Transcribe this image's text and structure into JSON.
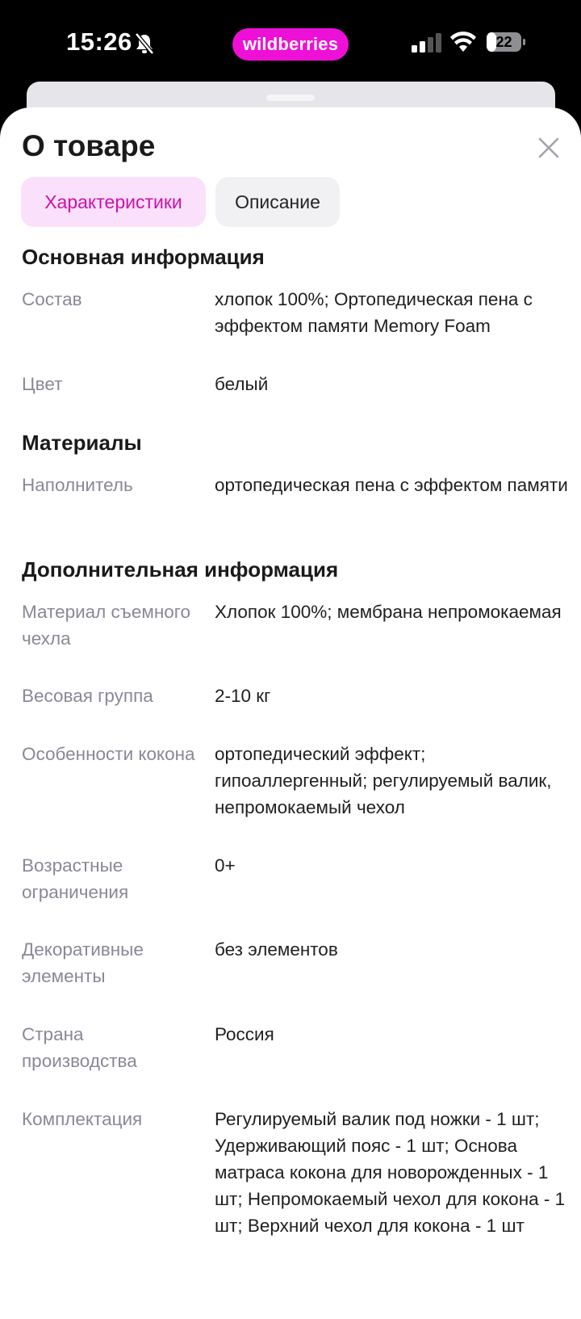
{
  "status_bar": {
    "time": "15:26",
    "app_pill": "wildberries",
    "battery": "22"
  },
  "colors": {
    "brand": "#ee10d6",
    "tab_active_bg": "#fbe0fb",
    "tab_active_text": "#cb11ab",
    "label": "#8a8896"
  },
  "sheet": {
    "title": "О товаре",
    "tabs": [
      {
        "label": "Характеристики",
        "active": true
      },
      {
        "label": "Описание",
        "active": false
      }
    ]
  },
  "sections": [
    {
      "title": "Основная информация",
      "rows": [
        {
          "label": "Состав",
          "value": "хлопок 100%; Ортопедическая пена с эффектом памяти Memory Foam"
        },
        {
          "label": "Цвет",
          "value": "белый"
        }
      ]
    },
    {
      "title": "Материалы",
      "rows": [
        {
          "label": "Наполнитель",
          "value": "ортопедическая пена с эффектом памяти"
        }
      ]
    },
    {
      "title": "Дополнительная информация",
      "rows": [
        {
          "label": "Материал съемного чехла",
          "value": "Хлопок 100%; мембрана непромокаемая"
        },
        {
          "label": "Весовая группа",
          "value": "2-10 кг"
        },
        {
          "label": "Особенности кокона",
          "value": "ортопедический эффект; гипоаллергенный; регулируемый валик, непромокаемый чехол"
        },
        {
          "label": "Возрастные ограничения",
          "value": "0+"
        },
        {
          "label": "Декоративные элементы",
          "value": "без элементов"
        },
        {
          "label": "Страна производства",
          "value": "Россия"
        },
        {
          "label": "Комплектация",
          "value": "Регулируемый валик под ножки - 1 шт; Удерживающий пояс - 1 шт; Основа матраса кокона для новорожденных - 1 шт; Непромокаемый чехол для кокона - 1 шт; Верхний чехол для кокона - 1 шт"
        }
      ]
    }
  ]
}
